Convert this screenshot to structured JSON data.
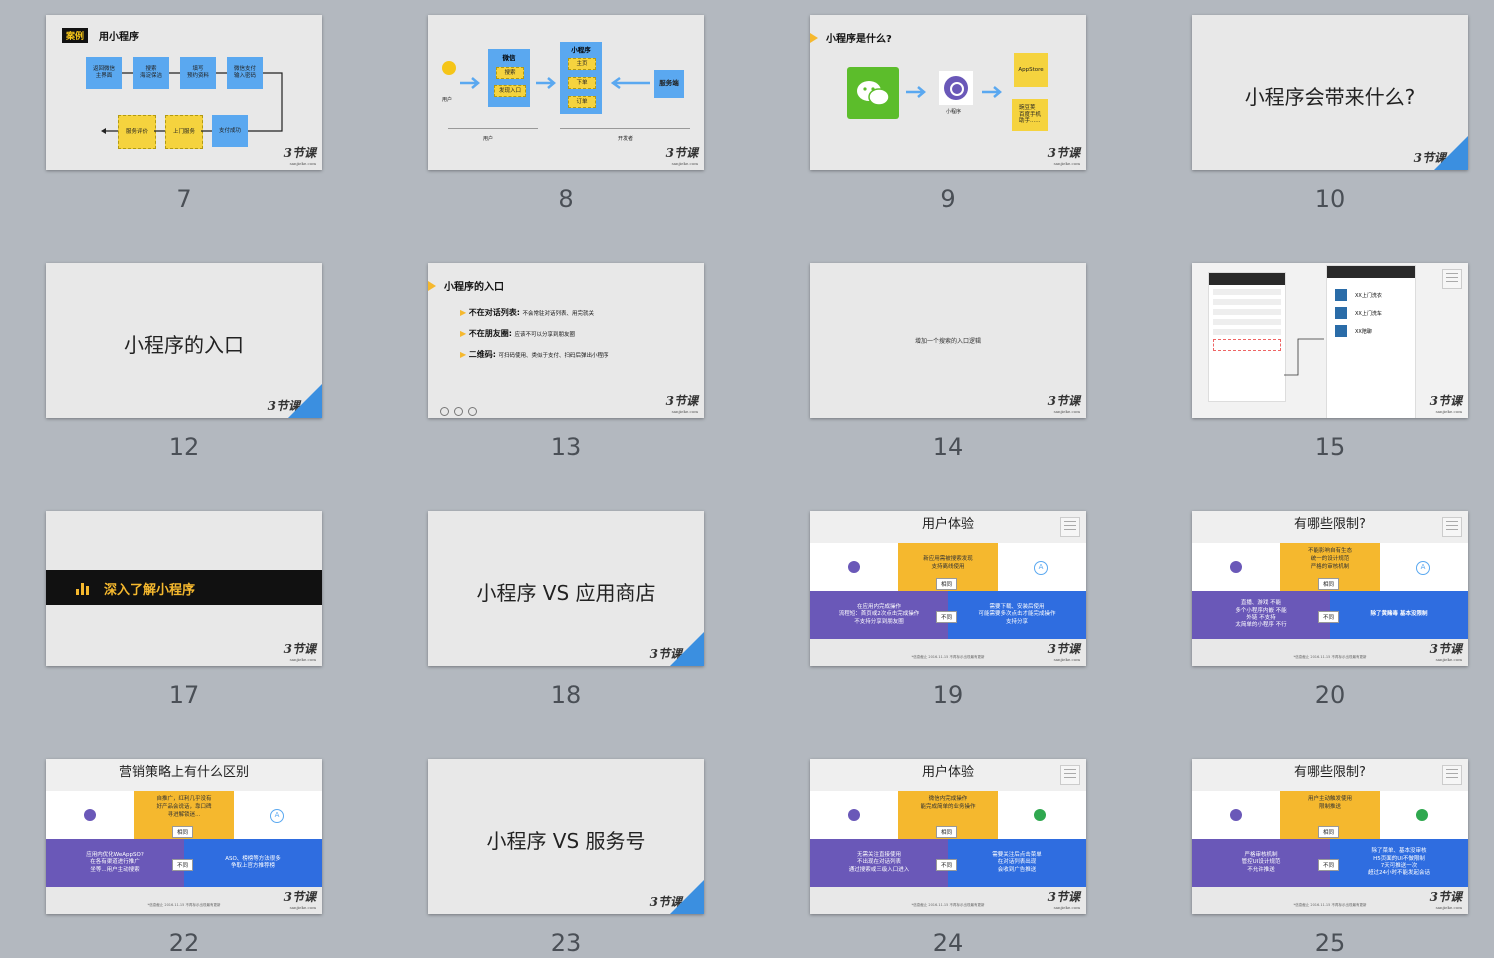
{
  "slides": [
    {
      "num": "7",
      "title_tag": "案例",
      "title": "用小程序",
      "boxes": [
        "返回微信\n主界面",
        "搜索\n海淀保洁",
        "填写\n预约资料",
        "微信支付\n输入密码",
        "服务评价",
        "上门服务",
        "支付成功"
      ]
    },
    {
      "num": "8",
      "user": "用户",
      "wechat": "微信",
      "search": "搜索",
      "found": "发现入口",
      "mp": "小程序",
      "home": "主页",
      "order_place": "下单",
      "order": "订单",
      "server": "服务端",
      "label_user": "用户",
      "label_dev": "开发者"
    },
    {
      "num": "9",
      "title": "小程序是什么?",
      "mp": "小程序",
      "appstore": "AppStore",
      "others": "豌豆荚\n百度手机\n助手......"
    },
    {
      "num": "10",
      "title": "小程序会带来什么?"
    },
    {
      "num": "12",
      "title": "小程序的入口"
    },
    {
      "num": "13",
      "title": "小程序的入口",
      "items": [
        {
          "h": "不在对话列表:",
          "t": "不会常驻对话列表、用完就关"
        },
        {
          "h": "不在朋友圈:",
          "t": "应该不可以分享到朋友圈"
        },
        {
          "h": "二维码:",
          "t": "可扫码使用、类似于支付、扫码后弹出小程序"
        }
      ]
    },
    {
      "num": "14",
      "text": "增加一个搜索的入口逻辑"
    },
    {
      "num": "15",
      "list": [
        "XX上门洗衣",
        "XX上门洗车",
        "XX陪聊"
      ]
    },
    {
      "num": "17",
      "title": "深入了解小程序"
    },
    {
      "num": "18",
      "title": "小程序 VS 应用商店"
    },
    {
      "num": "19",
      "title": "用户体验",
      "mid": "新应用需被搜索发现\n支持离线使用",
      "same": "相同",
      "diff": "不同",
      "left": "在应用内完成操作\n流程短：首页或2次点击完成操作\n不支持分享到朋友圈",
      "right": "需要下载、安装后使用\n可能需要多次点击才能完成操作\n支持分享"
    },
    {
      "num": "20",
      "title": "有哪些限制?",
      "mid": "不能影响自有生态\n统一的设计规范\n严格的审核机制",
      "same": "相同",
      "diff": "不同",
      "left": "直播、游戏 不能\n多个小程序内嵌 不能\n外链 不支持\n太简单的小程序 不行",
      "right": "除了黄赌毒 基本没限制"
    },
    {
      "num": "22",
      "title": "营销策略上有什么区别",
      "mid": "自推广，红利几乎没有\n好产品会说话，靠口碑\n寻进解锁迷...",
      "same": "相同",
      "diff": "不同",
      "left": "应用内优化WeAppSO?\n在各有渠道进行推广\n坐等...用户主动搜索",
      "right": "ASO、榜榜等方法很多\n争取上官方推荐榜"
    },
    {
      "num": "23",
      "title": "小程序 VS 服务号"
    },
    {
      "num": "24",
      "title": "用户体验",
      "mid": "微信内完成操作\n能完成简单的业务操作",
      "same": "相同",
      "diff": "不同",
      "left": "无需关注直接使用\n不出现在对话列表\n通过搜索或三级入口进入",
      "right": "需要关注后点击菜单\n在对话列表出现\n会收到广告推送"
    },
    {
      "num": "25",
      "title": "有哪些限制?",
      "mid": "用户主动触发使用\n限制推送",
      "same": "相同",
      "diff": "不同",
      "left": "严格审核机制\n管控UI设计规范\n不允许推送",
      "right": "除了菜单、基本没审核\nH5页面的UI不做限制\n7天可推送一次\n超过24小时不能发起会话"
    }
  ],
  "footer_note": "*信息截止 2016.11.15 不再标示出现最有更新",
  "logo": "3节课",
  "logo_sub": "sanjieke.com",
  "colors": {
    "bg": "#b3b8bf",
    "slide": "#e8e8e8",
    "blue": "#5aa8f0",
    "yellow": "#f5d33e",
    "purple": "#6a58b8",
    "royal": "#2f6de0",
    "orange": "#f5b82e",
    "black": "#111111"
  }
}
